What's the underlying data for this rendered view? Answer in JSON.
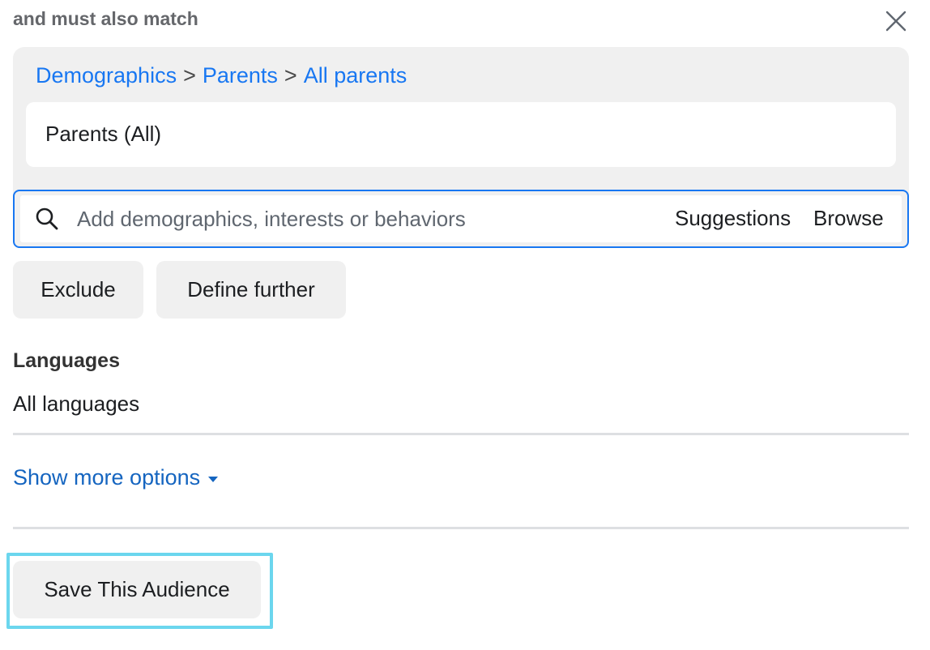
{
  "header": {
    "title": "and must also match",
    "close_icon": "close-icon"
  },
  "targeting": {
    "breadcrumb": [
      "Demographics",
      "Parents",
      "All parents"
    ],
    "breadcrumb_separator": ">",
    "selected_items": [
      "Parents (All)"
    ],
    "search": {
      "placeholder": "Add demographics, interests or behaviors",
      "value": "",
      "icon": "search-icon",
      "suggestions_label": "Suggestions",
      "browse_label": "Browse"
    }
  },
  "actions": {
    "exclude_label": "Exclude",
    "define_further_label": "Define further"
  },
  "languages": {
    "heading": "Languages",
    "value": "All languages"
  },
  "options": {
    "show_more_label": "Show more options",
    "caret_icon": "caret-down-icon"
  },
  "footer": {
    "save_label": "Save This Audience"
  },
  "colors": {
    "link": "#1877f2",
    "show_more": "#1565c0",
    "focus_border": "#1877f2",
    "highlight_outline": "#6bd6ee",
    "panel_bg": "#f0f0f0"
  }
}
